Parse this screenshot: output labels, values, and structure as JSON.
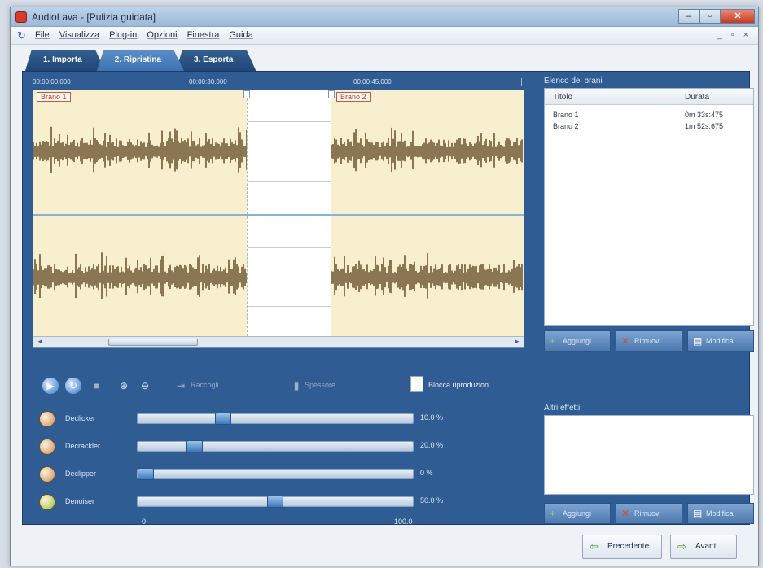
{
  "window": {
    "title": "AudioLava - [Pulizia guidata]",
    "controls": {
      "minimize": "–",
      "maximize": "▫",
      "close": "✕"
    },
    "mdi_controls": "_ ▫ ×"
  },
  "menu": {
    "items": [
      "File",
      "Visualizza",
      "Plug-in",
      "Opzioni",
      "Finestra",
      "Guida"
    ]
  },
  "tabs": [
    {
      "label": "1. Importa",
      "active": false
    },
    {
      "label": "2. Ripristina",
      "active": true
    },
    {
      "label": "3. Esporta",
      "active": false
    }
  ],
  "timeline": {
    "ruler": [
      "00:00:00.000",
      "00:00:30.000",
      "00:00:45.000"
    ],
    "clips": [
      "Brano 1",
      "Brano 2"
    ]
  },
  "toolbar": {
    "raccogli_label": "Raccogli",
    "spessore_label": "Spessore",
    "nuovo_label": "Blocca riproduzion..."
  },
  "effects": [
    {
      "label": "Declicker",
      "value_text": "10.0 %",
      "level": 0.3,
      "knob_color": "#c98a5b"
    },
    {
      "label": "Decrackler",
      "value_text": "20.0 %",
      "level": 0.19,
      "knob_color": "#c98a5b"
    },
    {
      "label": "Declipper",
      "value_text": "0 %",
      "level": 0.0,
      "knob_color": "#c98a5b"
    },
    {
      "label": "Denoiser",
      "value_text": "50.0 %",
      "level": 0.5,
      "knob_color": "#9bbf3a"
    }
  ],
  "effect_scale": {
    "min": "0",
    "max": "100.0"
  },
  "track_list": {
    "title": "Elenco dei brani",
    "columns": [
      "Titolo",
      "Durata"
    ],
    "rows": [
      [
        "Brano 1",
        "0m 33s:475"
      ],
      [
        "Brano 2",
        "1m 52s:675"
      ]
    ],
    "buttons": [
      "Aggiungi",
      "Rimuovi",
      "Modifica"
    ]
  },
  "other_effects": {
    "title": "Altri effetti",
    "buttons": [
      "Aggiungi",
      "Rimuovi",
      "Modifica"
    ]
  },
  "nav": {
    "prev": "Precedente",
    "next": "Avanti"
  },
  "colors": {
    "panel": "#2f5d93",
    "waveform": "#8a7652",
    "track_bg": "#f8efcf"
  }
}
